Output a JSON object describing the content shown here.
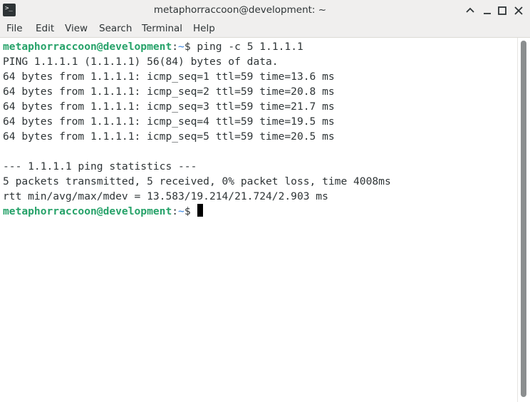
{
  "window": {
    "title": "metaphorraccoon@development: ~",
    "icon": "terminal-icon",
    "controls": {
      "maximize_up": "⌃",
      "minimize": "–",
      "restore": "◻",
      "close": "✕"
    }
  },
  "menubar": {
    "items": [
      "File",
      "Edit",
      "View",
      "Search",
      "Terminal",
      "Help"
    ]
  },
  "terminal": {
    "prompt": {
      "user_host": "metaphorraccoon@development",
      "colon": ":",
      "path": "~",
      "symbol": "$"
    },
    "command": " ping -c 5 1.1.1.1",
    "output": [
      "PING 1.1.1.1 (1.1.1.1) 56(84) bytes of data.",
      "64 bytes from 1.1.1.1: icmp_seq=1 ttl=59 time=13.6 ms",
      "64 bytes from 1.1.1.1: icmp_seq=2 ttl=59 time=20.8 ms",
      "64 bytes from 1.1.1.1: icmp_seq=3 ttl=59 time=21.7 ms",
      "64 bytes from 1.1.1.1: icmp_seq=4 ttl=59 time=19.5 ms",
      "64 bytes from 1.1.1.1: icmp_seq=5 ttl=59 time=20.5 ms",
      "",
      "--- 1.1.1.1 ping statistics ---",
      "5 packets transmitted, 5 received, 0% packet loss, time 4008ms",
      "rtt min/avg/max/mdev = 13.583/19.214/21.724/2.903 ms"
    ],
    "colors": {
      "user_host": "#26a269",
      "path": "#3584e4",
      "text": "#2e3436"
    }
  }
}
